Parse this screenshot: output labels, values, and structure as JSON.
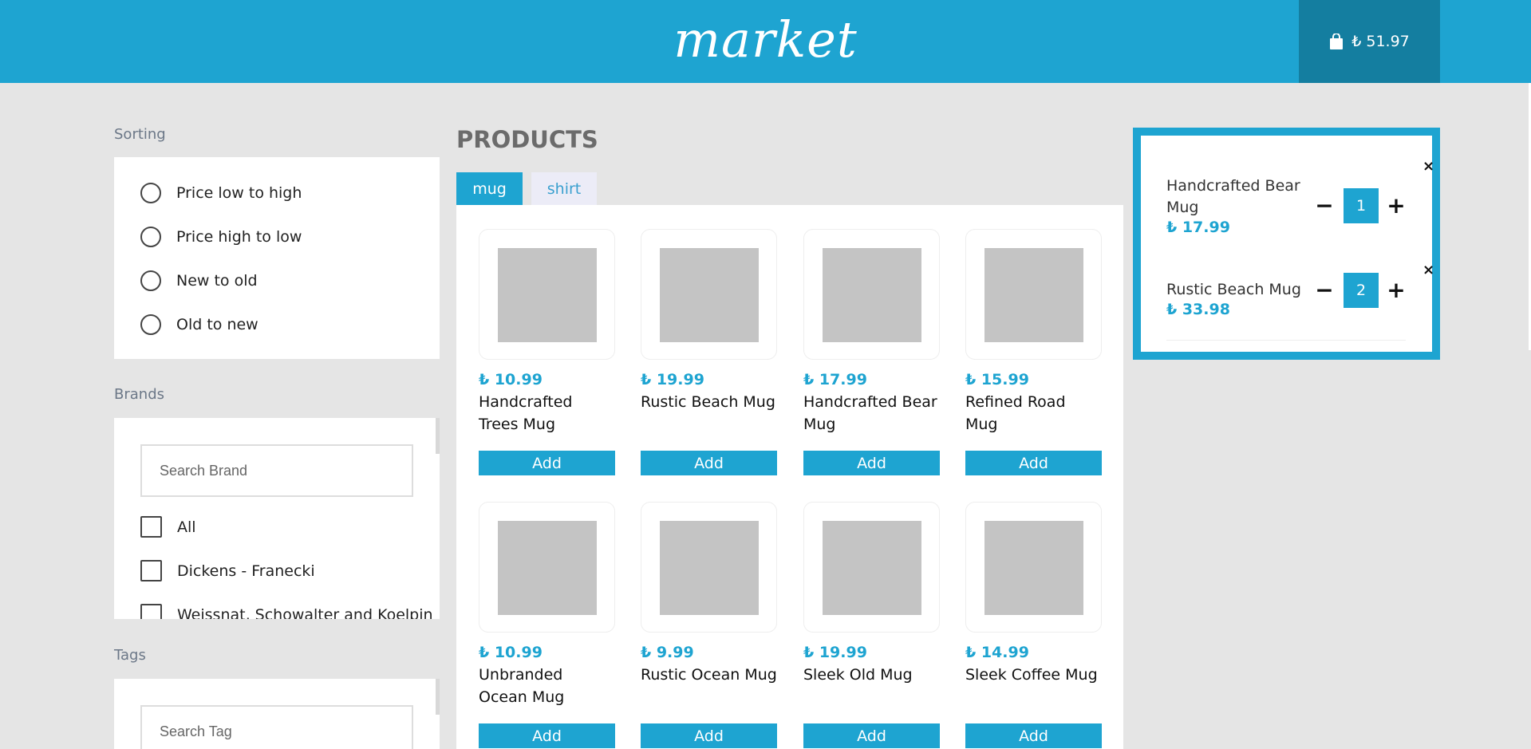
{
  "header": {
    "logo": "market",
    "cart_total": "₺ 51.97",
    "cart_icon": "shopping-bag-icon",
    "color": "#1ea4d1",
    "cart_color": "#147ea0"
  },
  "sorting": {
    "title": "Sorting",
    "options": [
      "Price low to high",
      "Price high to low",
      "New to old",
      "Old to new"
    ]
  },
  "brands": {
    "title": "Brands",
    "search_placeholder": "Search Brand",
    "items": [
      "All",
      "Dickens - Franecki",
      "Weissnat, Schowalter and Koelpin"
    ]
  },
  "tags": {
    "title": "Tags",
    "search_placeholder": "Search Tag"
  },
  "products": {
    "title": "PRODUCTS",
    "tabs": [
      "mug",
      "shirt"
    ],
    "active_tab": "mug",
    "add_label": "Add",
    "items": [
      {
        "price": "₺ 10.99",
        "name": "Handcrafted Trees Mug"
      },
      {
        "price": "₺ 19.99",
        "name": "Rustic Beach Mug"
      },
      {
        "price": "₺ 17.99",
        "name": "Handcrafted Bear Mug"
      },
      {
        "price": "₺ 15.99",
        "name": "Refined Road Mug"
      },
      {
        "price": "₺ 10.99",
        "name": "Unbranded Ocean Mug"
      },
      {
        "price": "₺ 9.99",
        "name": "Rustic Ocean Mug"
      },
      {
        "price": "₺ 19.99",
        "name": "Sleek Old Mug"
      },
      {
        "price": "₺ 14.99",
        "name": "Sleek Coffee Mug"
      }
    ]
  },
  "basket": {
    "items": [
      {
        "name": "Handcrafted Bear Mug",
        "price": "₺ 17.99",
        "qty": "1"
      },
      {
        "name": "Rustic Beach Mug",
        "price": "₺ 33.98",
        "qty": "2"
      }
    ],
    "remove_symbol": "×",
    "minus_symbol": "−",
    "plus_symbol": "+"
  }
}
